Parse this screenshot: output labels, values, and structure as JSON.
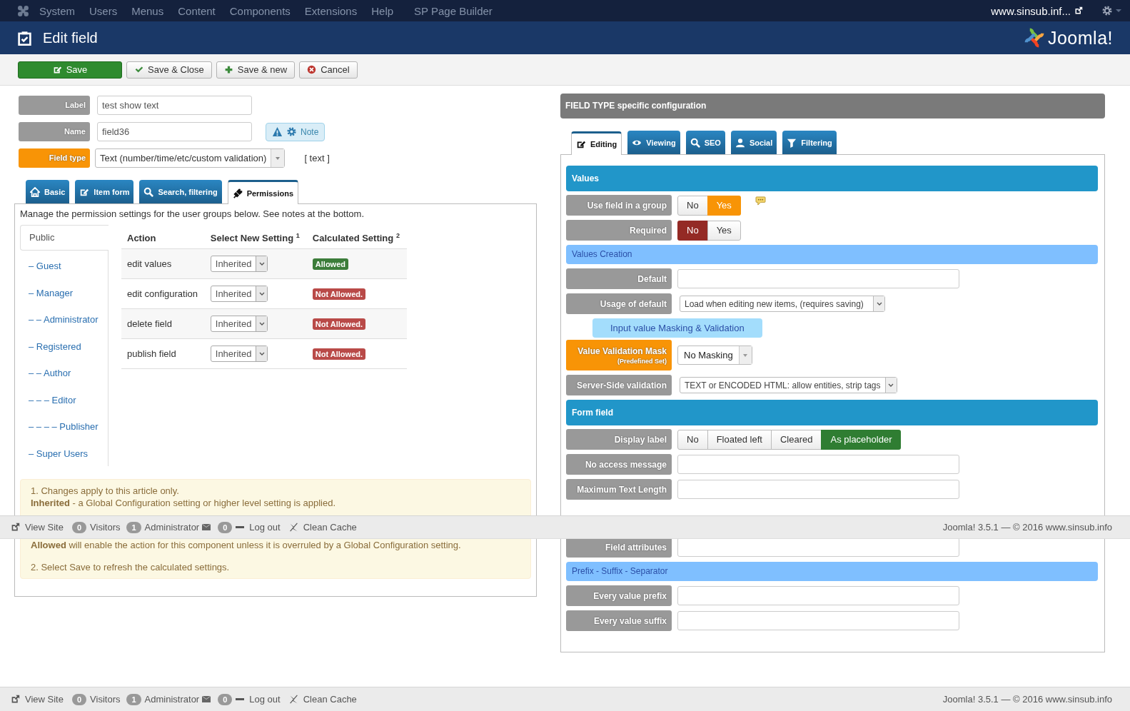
{
  "top_menu": {
    "items": [
      "System",
      "Users",
      "Menus",
      "Content",
      "Components",
      "Extensions",
      "Help",
      "SP Page Builder"
    ],
    "site_link": "www.sinsub.inf..."
  },
  "header": {
    "title": "Edit field",
    "logo_text": "Joomla!"
  },
  "toolbar": {
    "buttons": [
      {
        "label": "Save",
        "kind": "save"
      },
      {
        "label": "Save & Close",
        "kind": "check"
      },
      {
        "label": "Save & new",
        "kind": "plus"
      },
      {
        "label": "Cancel",
        "kind": "cancel"
      }
    ]
  },
  "fields": [
    {
      "label": "Label",
      "value": "test show text",
      "kind": "text",
      "color": "#999999"
    },
    {
      "label": "Name",
      "value": "field36",
      "kind": "text",
      "color": "#999999",
      "note": "Note"
    },
    {
      "label": "Field type",
      "value": "Text (number/time/etc/custom validation)",
      "kind": "dropdown",
      "color": "#f89406",
      "hint": "[ text ]"
    }
  ],
  "tabs": [
    {
      "label": "Basic",
      "kind": "home",
      "selected": false
    },
    {
      "label": "Item form",
      "kind": "edit",
      "selected": false
    },
    {
      "label": "Search, filtering",
      "kind": "search",
      "selected": false
    },
    {
      "label": "Permissions",
      "kind": "plug",
      "selected": true
    }
  ],
  "permissions": {
    "intro": "Manage the permission settings for the user groups below. See notes at the bottom.",
    "groups": [
      {
        "label": "Public",
        "selected": true,
        "children": [
          {
            "label": "– Guest",
            "selected": false
          },
          {
            "label": "– Manager",
            "selected": false,
            "children": [
              {
                "label": "– – Administrator",
                "selected": false
              }
            ]
          },
          {
            "label": "– Registered",
            "selected": false,
            "children": [
              {
                "label": "– – Author",
                "selected": false,
                "children": [
                  {
                    "label": "– – – Editor",
                    "selected": false,
                    "children": [
                      {
                        "label": "– – – – Publisher",
                        "selected": false
                      }
                    ]
                  }
                ]
              }
            ]
          },
          {
            "label": "– Super Users",
            "selected": false
          }
        ]
      }
    ],
    "columns": [
      "Action",
      "Select New Setting $^{1}$",
      "Calculated Setting $^{2}$"
    ],
    "actions": [
      {
        "action": "edit values",
        "setting": "Inherited",
        "calculated": "Allowed",
        "allowed": true
      },
      {
        "action": "edit configuration",
        "setting": "Inherited",
        "calculated": "Not Allowed.",
        "allowed": false
      },
      {
        "action": "delete field",
        "setting": "Inherited",
        "calculated": "Not Allowed.",
        "allowed": false
      },
      {
        "action": "publish field",
        "setting": "Inherited",
        "calculated": "Not Allowed.",
        "allowed": false
      }
    ],
    "notes": [
      "1. Changes apply to this article only.",
      "**Inherited** - a Global Configuration setting or higher level setting is applied.",
      "**Allowed** will enable the action for this component unless it is overruled by a Global Configuration setting.",
      "2. Select Save to refresh the calculated settings."
    ]
  },
  "config": {
    "title": "FIELD TYPE specific configuration",
    "tabs": [
      {
        "label": "Editing",
        "kind": "edit",
        "selected": true
      },
      {
        "label": "Viewing",
        "kind": "eye",
        "selected": false
      },
      {
        "label": "SEO",
        "kind": "search",
        "selected": false
      },
      {
        "label": "Social",
        "kind": "user",
        "selected": false
      },
      {
        "label": "Filtering",
        "kind": "filter",
        "selected": false
      }
    ],
    "rows": [
      {
        "kind": "header",
        "label": "Values"
      },
      {
        "kind": "toggle",
        "label": "Use field in a group",
        "tip": true,
        "options": [
          {
            "label": "No",
            "selected": false
          },
          {
            "label": "Yes",
            "selected": true,
            "color": "#f89406"
          }
        ]
      },
      {
        "kind": "toggle",
        "label": "Required",
        "options": [
          {
            "label": "No",
            "selected": true,
            "color": "#942a25"
          },
          {
            "label": "Yes",
            "selected": false
          }
        ]
      },
      {
        "kind": "subheader",
        "label": "Values Creation"
      },
      {
        "kind": "input",
        "label": "Default"
      },
      {
        "kind": "select",
        "label": "Usage of default",
        "value": "Load when editing new items, (requires saving)"
      },
      {
        "kind": "subtitle",
        "label": "Input value Masking & Validation"
      },
      {
        "kind": "dropdown",
        "label": "Value Validation Mask",
        "sublabel": "(Predefined Set)",
        "color": "#f89406",
        "value": "No Masking"
      },
      {
        "kind": "select",
        "label": "Server-Side validation",
        "value": "TEXT or ENCODED HTML: allow entities, strip tags"
      },
      {
        "kind": "header",
        "label": "Form field"
      },
      {
        "kind": "toggle",
        "label": "Display label",
        "options": [
          {
            "label": "No",
            "selected": false
          },
          {
            "label": "Floated left",
            "selected": false
          },
          {
            "label": "Cleared",
            "selected": false
          },
          {
            "label": "As placeholder",
            "selected": true,
            "color": "#2f7d32"
          }
        ]
      },
      {
        "kind": "input",
        "label": "No access message"
      },
      {
        "kind": "input",
        "label": "Maximum Text Length"
      },
      {
        "kind": "input",
        "label": "Field attributes"
      },
      {
        "kind": "subheader",
        "label": "Prefix - Suffix - Separator"
      },
      {
        "kind": "input",
        "label": "Every value prefix"
      },
      {
        "kind": "input",
        "label": "Every value suffix"
      }
    ]
  },
  "overlay_status_bar": {
    "view_site": "View Site",
    "visitors_count": "0",
    "visitors": "Visitors",
    "admins_count": "1",
    "admins": "Administrator",
    "messages_count": "0",
    "logout": "Log out",
    "clean_cache": "Clean Cache",
    "version": "Joomla! 3.5.1 — © 2016 www.sinsub.info"
  },
  "status_bar": {
    "view_site": "View Site",
    "visitors_count": "0",
    "visitors": "Visitors",
    "admins_count": "1",
    "admins": "Administrator",
    "messages_count": "0",
    "logout": "Log out",
    "clean_cache": "Clean Cache",
    "version": "Joomla! 3.5.1 — © 2016 www.sinsub.info"
  }
}
